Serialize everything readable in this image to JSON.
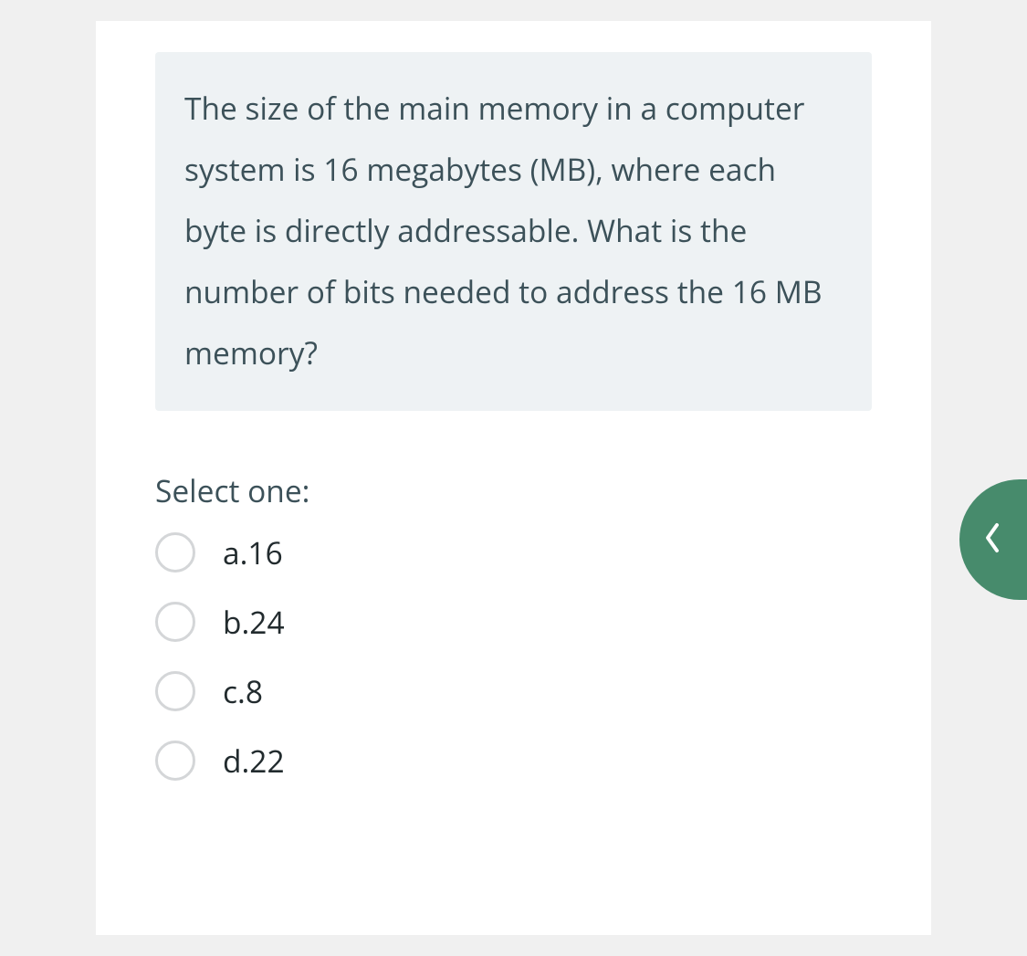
{
  "question": {
    "text": "The size of the main memory in a computer system is 16 megabytes (MB), where each byte is directly addressable.  What is the number of bits needed to address the 16 MB memory?"
  },
  "prompt": "Select one:",
  "options": [
    {
      "label": "a.16"
    },
    {
      "label": "b.24"
    },
    {
      "label": "c.8"
    },
    {
      "label": "d.22"
    }
  ]
}
